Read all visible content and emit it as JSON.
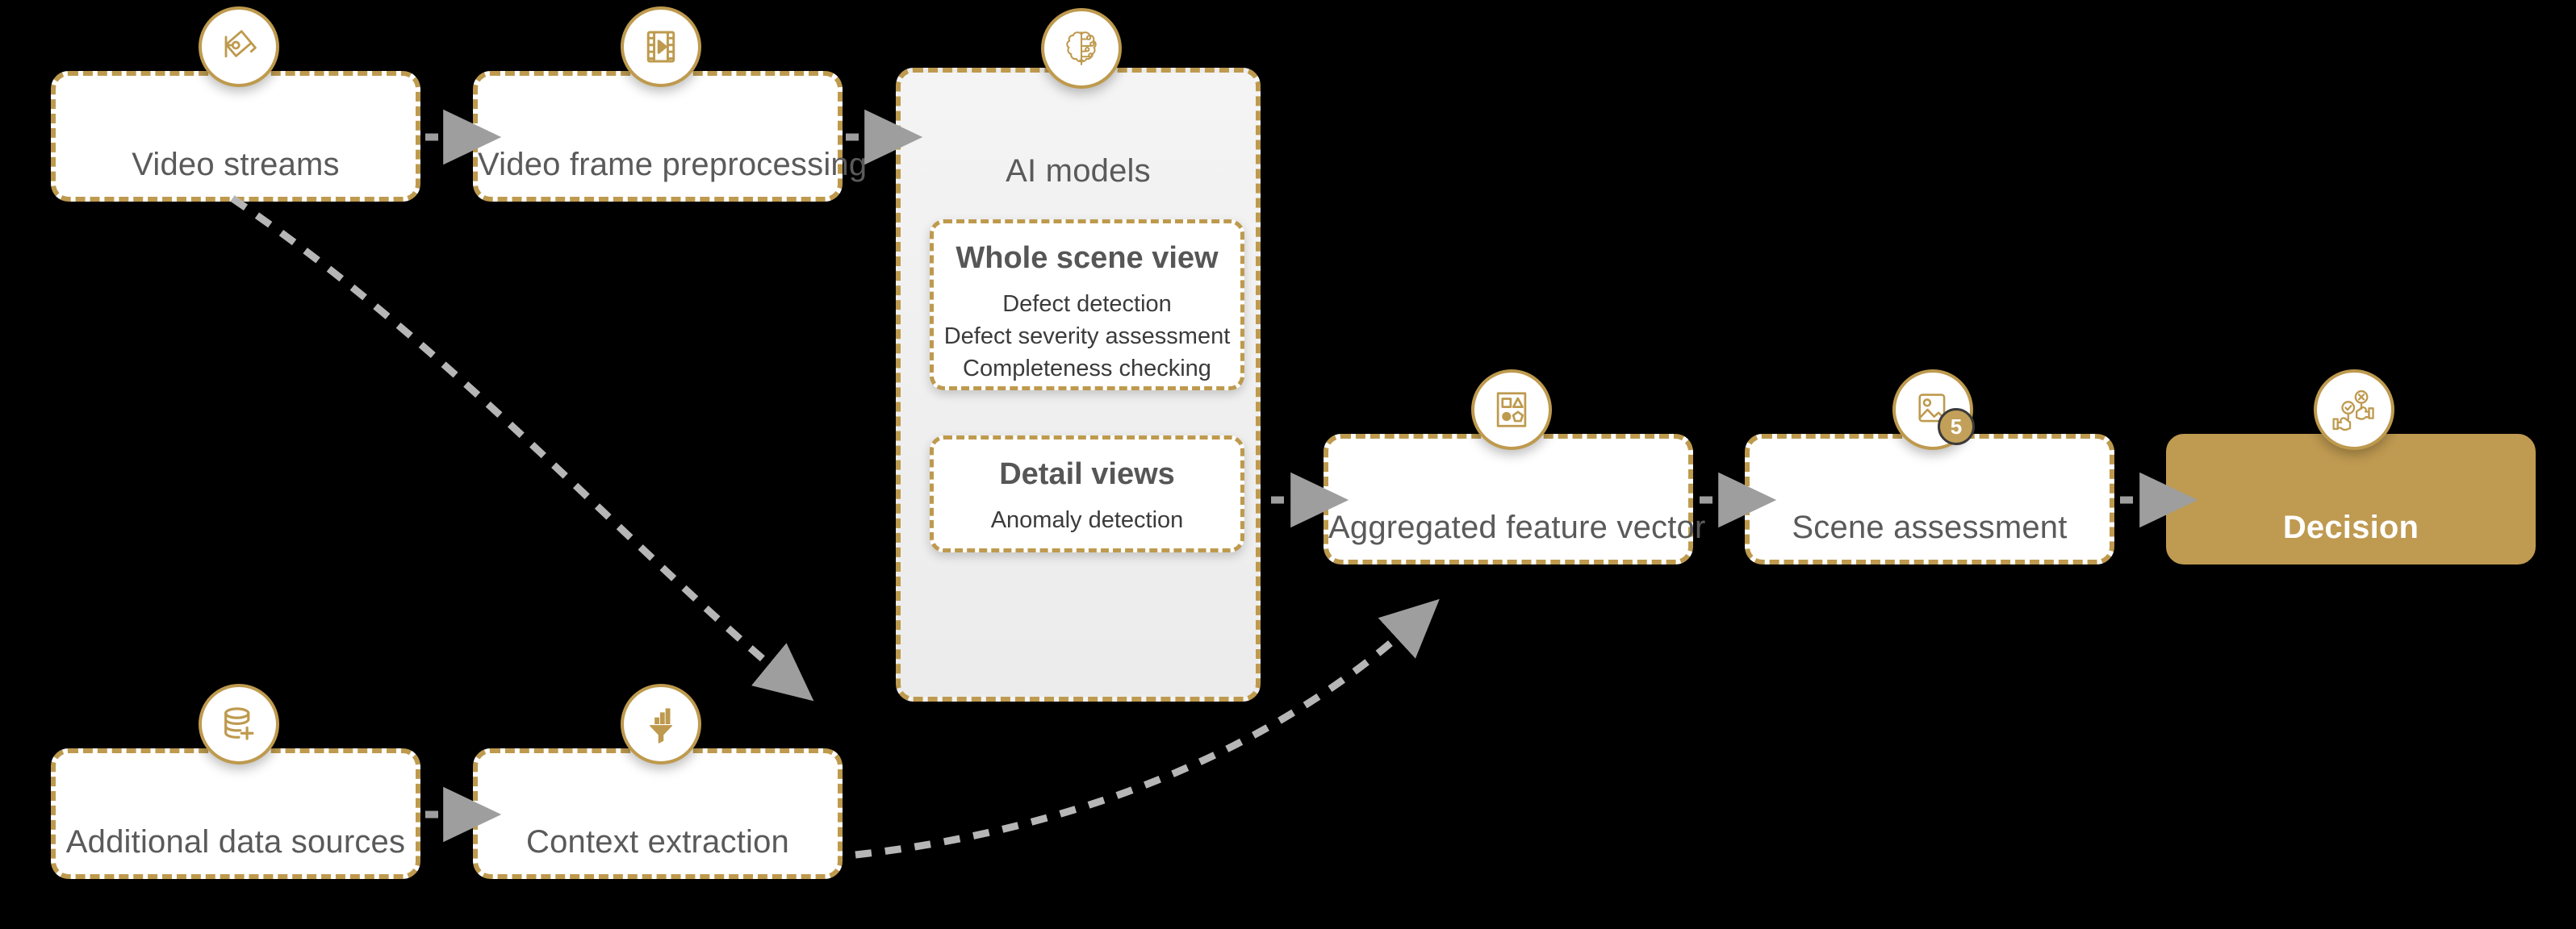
{
  "theme": {
    "gold": "#BE9A4E",
    "gold_fill": "#BF9A51",
    "node_bg": "#FFFFFF",
    "group_bg": "#F2F2F2",
    "label_color": "#5A5A5A",
    "connector_color": "#9E9E9E",
    "canvas_bg": "#000000"
  },
  "nodes": {
    "video_streams": {
      "label": "Video streams",
      "icon": "security-camera-icon"
    },
    "video_frame_preprocessing": {
      "label": "Video frame preprocessing",
      "icon": "film-play-icon"
    },
    "ai_models": {
      "label": "AI models",
      "icon": "brain-circuit-icon"
    },
    "aggregated_feature_vector": {
      "label": "Aggregated feature vector",
      "icon": "shapes-grid-icon"
    },
    "scene_assessment": {
      "label": "Scene assessment",
      "icon": "image-stack-icon",
      "badge_count": "5"
    },
    "decision": {
      "label": "Decision",
      "icon": "approve-reject-hands-icon"
    },
    "additional_data_sources": {
      "label": "Additional data sources",
      "icon": "database-add-icon"
    },
    "context_extraction": {
      "label": "Context extraction",
      "icon": "funnel-chart-icon"
    }
  },
  "ai_models_groups": [
    {
      "title": "Whole scene view",
      "items": [
        "Defect detection",
        "Defect severity assessment",
        "Completeness checking"
      ]
    },
    {
      "title": "Detail views",
      "items": [
        "Anomaly detection"
      ]
    }
  ]
}
